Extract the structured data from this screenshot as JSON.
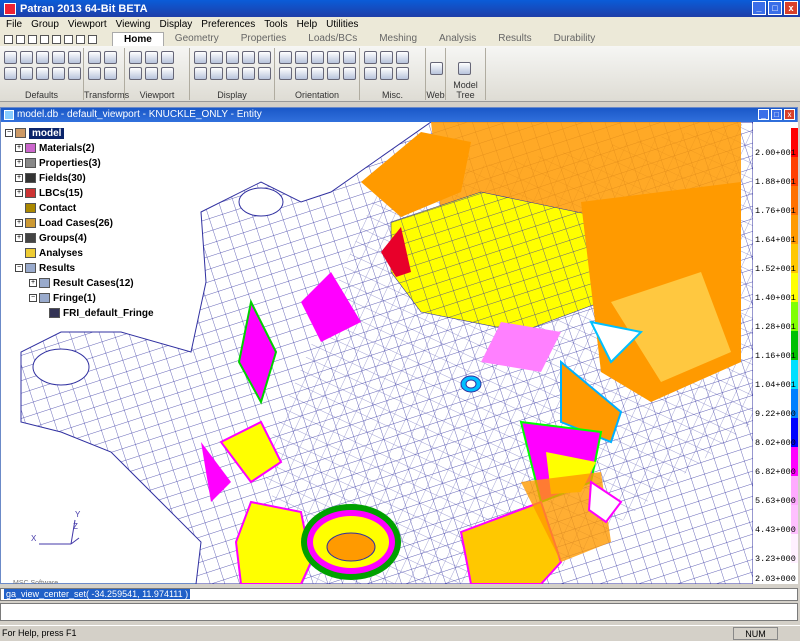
{
  "window": {
    "title": "Patran 2013 64-Bit BETA"
  },
  "menu": [
    "File",
    "Group",
    "Viewport",
    "Viewing",
    "Display",
    "Preferences",
    "Tools",
    "Help",
    "Utilities"
  ],
  "ribbon_tabs": [
    "Home",
    "Geometry",
    "Properties",
    "Loads/BCs",
    "Meshing",
    "Analysis",
    "Results",
    "Durability"
  ],
  "ribbon_groups": [
    "Defaults",
    "Transforms",
    "Viewport",
    "Display",
    "Orientation",
    "Misc.",
    "Web",
    "Model Tree"
  ],
  "viewport": {
    "title": "model.db - default_viewport - KNUCKLE_ONLY - Entity"
  },
  "tree": {
    "root": "model",
    "items": [
      {
        "label": "Materials(2)"
      },
      {
        "label": "Properties(3)"
      },
      {
        "label": "Fields(30)"
      },
      {
        "label": "LBCs(15)"
      },
      {
        "label": "Contact"
      },
      {
        "label": "Load Cases(26)"
      },
      {
        "label": "Groups(4)"
      },
      {
        "label": "Analyses"
      },
      {
        "label": "Results"
      },
      {
        "label": "Result Cases(12)"
      },
      {
        "label": "Fringe(1)"
      },
      {
        "label": "FRI_default_Fringe"
      }
    ]
  },
  "legend": {
    "values": [
      "2.00+001",
      "1.88+001",
      "1.76+001",
      "1.64+001",
      "1.52+001",
      "1.40+001",
      "1.28+001",
      "1.16+001",
      "1.04+001",
      "9.22+000",
      "8.02+000",
      "6.82+000",
      "5.63+000",
      "4.43+000",
      "3.23+000",
      "2.03+000"
    ],
    "colors": [
      "#ff0000",
      "#ff3000",
      "#ff6000",
      "#ff9a00",
      "#ffc800",
      "#ffff00",
      "#00a0ff",
      "#0060ff",
      "#00d000",
      "#00ff00",
      "#ffaaff",
      "#ff00ff",
      "#ffaaff",
      "#ff80c0",
      "#ffff80",
      "#ff9000"
    ]
  },
  "triad": {
    "x": "X",
    "y": "Y",
    "z": "Z"
  },
  "command_line": {
    "text": "ga_view_center_set( -34.259541, 11.974111 )"
  },
  "status": {
    "help": "For Help, press F1",
    "num": "NUM"
  }
}
